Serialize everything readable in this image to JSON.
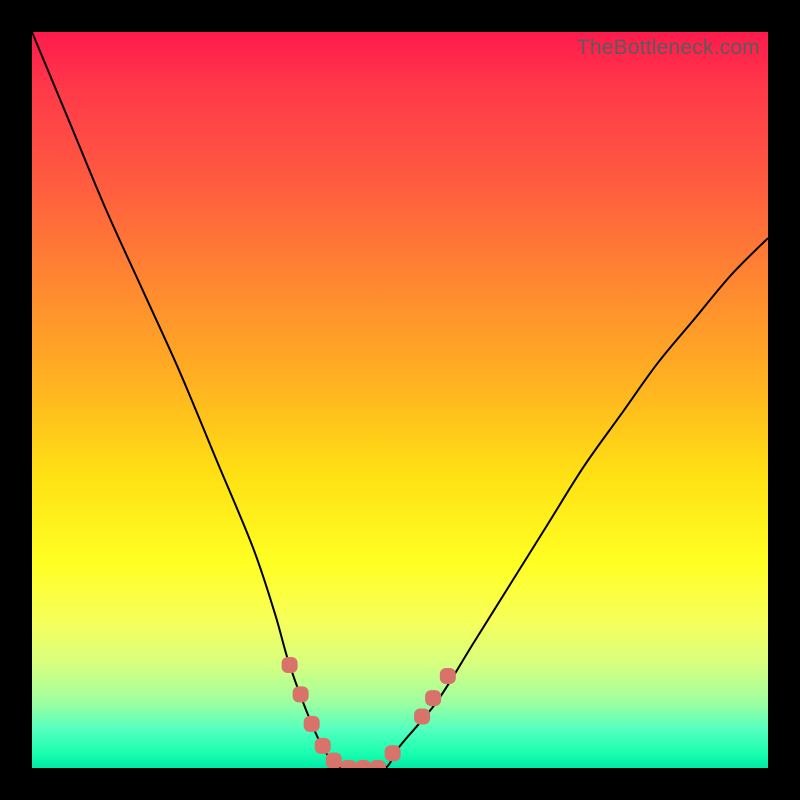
{
  "watermark": "TheBottleneck.com",
  "chart_data": {
    "type": "line",
    "title": "",
    "xlabel": "",
    "ylabel": "",
    "xlim": [
      0,
      100
    ],
    "ylim": [
      0,
      100
    ],
    "grid": false,
    "legend": false,
    "series": [
      {
        "name": "bottleneck-curve",
        "x": [
          0,
          5,
          10,
          15,
          20,
          25,
          30,
          33,
          35,
          38,
          40,
          42,
          45,
          48,
          50,
          55,
          60,
          65,
          70,
          75,
          80,
          85,
          90,
          95,
          100
        ],
        "y": [
          100,
          88,
          76,
          65,
          54,
          42,
          30,
          21,
          14,
          6,
          2,
          0,
          0,
          0,
          3,
          9,
          17,
          25,
          33,
          41,
          48,
          55,
          61,
          67,
          72
        ]
      }
    ],
    "markers": {
      "name": "highlight-points",
      "color": "#d8736c",
      "points": [
        {
          "x": 35,
          "y": 14
        },
        {
          "x": 36.5,
          "y": 10
        },
        {
          "x": 38,
          "y": 6
        },
        {
          "x": 39.5,
          "y": 3
        },
        {
          "x": 41,
          "y": 1
        },
        {
          "x": 43,
          "y": 0
        },
        {
          "x": 45,
          "y": 0
        },
        {
          "x": 47,
          "y": 0
        },
        {
          "x": 49,
          "y": 2
        },
        {
          "x": 53,
          "y": 7
        },
        {
          "x": 54.5,
          "y": 9.5
        },
        {
          "x": 56.5,
          "y": 12.5
        }
      ]
    },
    "background_gradient": {
      "top": "#ff1a4d",
      "mid_upper": "#ff8a30",
      "mid": "#ffe014",
      "mid_lower": "#d6ff80",
      "bottom": "#00e9a6"
    }
  }
}
